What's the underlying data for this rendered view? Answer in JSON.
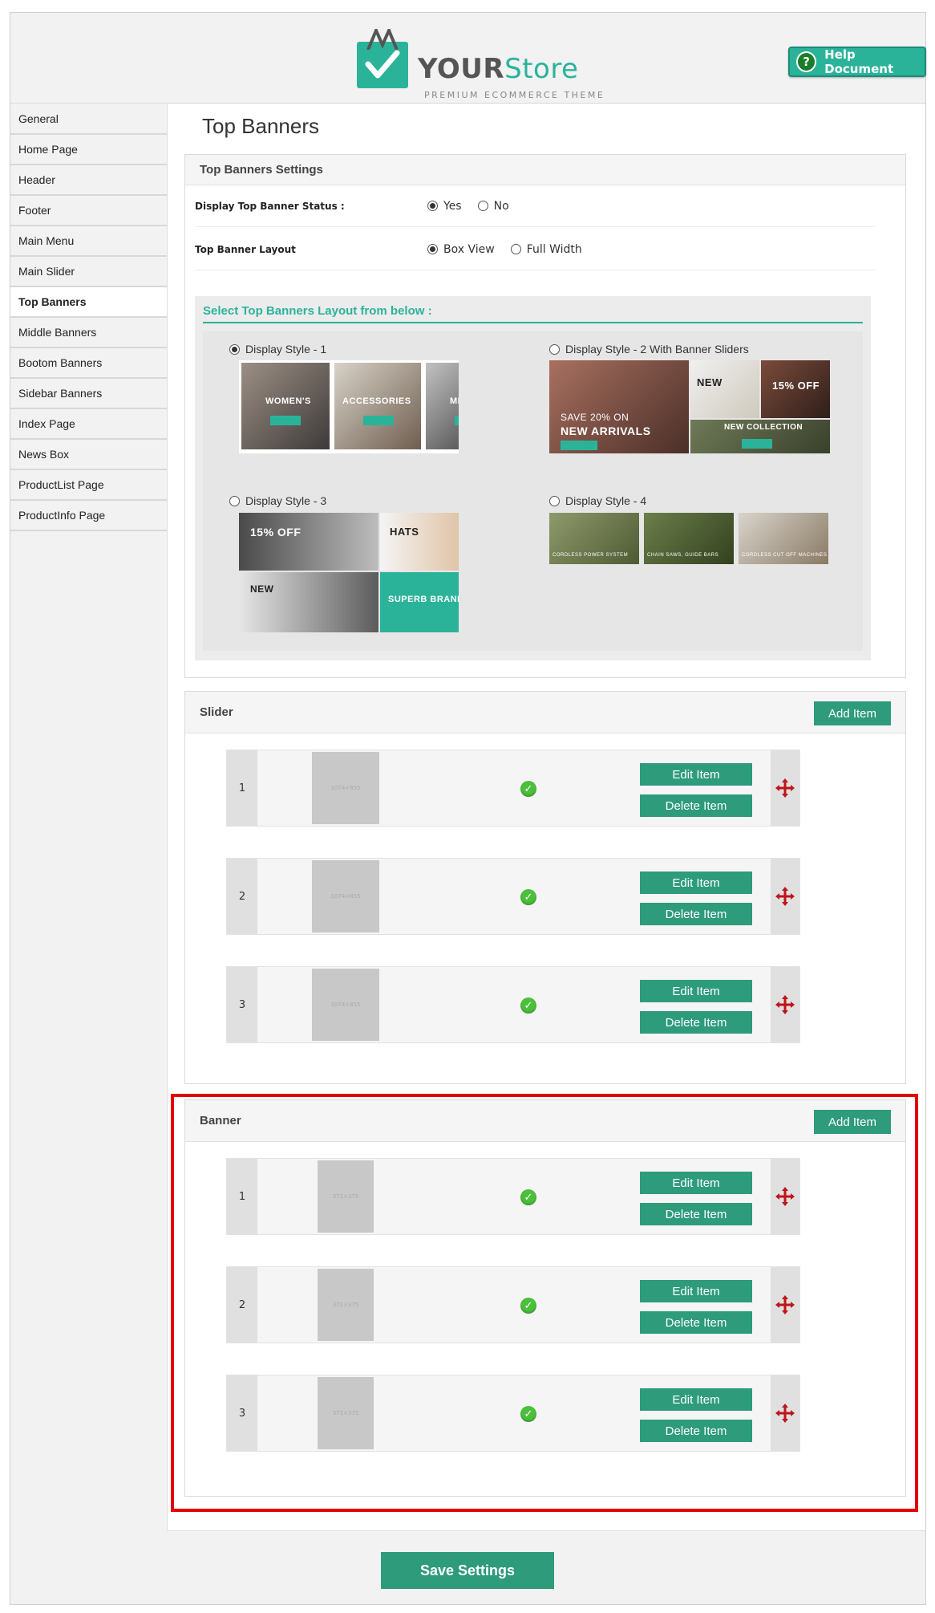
{
  "header": {
    "brand_your": "YOUR",
    "brand_store": "Store",
    "tagline": "PREMIUM ECOMMERCE THEME",
    "help_label": "Help Document",
    "help_glyph": "?"
  },
  "sidebar": {
    "items": [
      {
        "label": "General"
      },
      {
        "label": "Home Page"
      },
      {
        "label": "Header"
      },
      {
        "label": "Footer"
      },
      {
        "label": "Main Menu"
      },
      {
        "label": "Main Slider"
      },
      {
        "label": "Top Banners"
      },
      {
        "label": "Middle Banners"
      },
      {
        "label": "Bootom Banners"
      },
      {
        "label": "Sidebar Banners"
      },
      {
        "label": "Index Page"
      },
      {
        "label": "News Box"
      },
      {
        "label": "ProductList Page"
      },
      {
        "label": "ProductInfo Page"
      }
    ],
    "active": "Top Banners"
  },
  "page": {
    "title": "Top Banners"
  },
  "settings": {
    "title": "Top Banners Settings",
    "status_label": "Display Top Banner Status :",
    "status_options": [
      "Yes",
      "No"
    ],
    "status_value": "Yes",
    "layout_label": "Top Banner Layout",
    "layout_options": [
      "Box View",
      "Full Width"
    ],
    "layout_value": "Box View",
    "layout_select_title": "Select Top Banners Layout from below :",
    "styles": [
      {
        "label": "Display Style - 1",
        "selected": true,
        "tiles": [
          "WOMEN'S",
          "ACCESSORIES",
          "MEN'S"
        ]
      },
      {
        "label": "Display Style - 2 With Banner Sliders",
        "selected": false,
        "tiles": [
          "SAVE 20% ON",
          "NEW ARRIVALS",
          "NEW",
          "15% OFF",
          "NEW COLLECTION"
        ]
      },
      {
        "label": "Display Style - 3",
        "selected": false,
        "tiles": [
          "15% OFF",
          "HATS",
          "NEW",
          "SUPERB BRANDS"
        ]
      },
      {
        "label": "Display Style - 4",
        "selected": false,
        "tiles": [
          "CORDLESS POWER SYSTEM",
          "CHAIN SAWS, GUIDE BARS",
          "CORDLESS CUT OFF MACHINES"
        ]
      }
    ]
  },
  "slider": {
    "title": "Slider",
    "add_label": "Add Item",
    "items": [
      {
        "num": "1",
        "img_text": "1074×855"
      },
      {
        "num": "2",
        "img_text": "1074×855"
      },
      {
        "num": "3",
        "img_text": "1074×855"
      }
    ]
  },
  "banner": {
    "title": "Banner",
    "add_label": "Add Item",
    "items": [
      {
        "num": "1",
        "img_text": "371×375"
      },
      {
        "num": "2",
        "img_text": "371×375"
      },
      {
        "num": "3",
        "img_text": "371×375"
      }
    ]
  },
  "item_actions": {
    "edit_label": "Edit Item",
    "delete_label": "Delete Item",
    "check_glyph": "✓"
  },
  "footer": {
    "save_label": "Save Settings"
  },
  "colors": {
    "accent": "#2bb39a",
    "button": "#2e9b7b",
    "highlight": "#e30000",
    "move_icon": "#c0141a"
  }
}
